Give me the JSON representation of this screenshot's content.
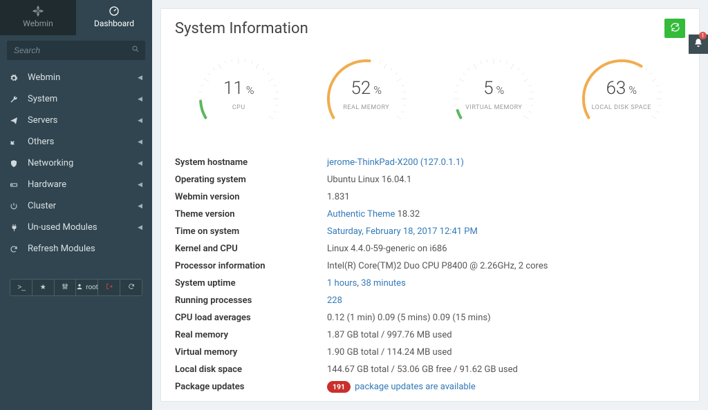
{
  "tabs": {
    "webmin": "Webmin",
    "dashboard": "Dashboard"
  },
  "search": {
    "placeholder": "Search"
  },
  "nav": {
    "items": [
      {
        "icon": "gear-icon",
        "label": "Webmin",
        "key": "webmin"
      },
      {
        "icon": "wrench-icon",
        "label": "System",
        "key": "system"
      },
      {
        "icon": "paperplane-icon",
        "label": "Servers",
        "key": "servers"
      },
      {
        "icon": "puzzle-icon",
        "label": "Others",
        "key": "others"
      },
      {
        "icon": "shield-icon",
        "label": "Networking",
        "key": "networking"
      },
      {
        "icon": "drive-icon",
        "label": "Hardware",
        "key": "hardware"
      },
      {
        "icon": "power-icon",
        "label": "Cluster",
        "key": "cluster"
      },
      {
        "icon": "plug-icon",
        "label": "Un-used Modules",
        "key": "unused"
      },
      {
        "icon": "refresh-icon",
        "label": "Refresh Modules",
        "key": "refresh",
        "no_chevron": true
      }
    ]
  },
  "bottombar": {
    "user_label": "root"
  },
  "notifications": {
    "count": "1"
  },
  "page": {
    "title": "System Information"
  },
  "gauges": [
    {
      "value": "11",
      "label": "CPU",
      "color": "#5cb85c"
    },
    {
      "value": "52",
      "label": "REAL MEMORY",
      "color": "#f0ad4e"
    },
    {
      "value": "5",
      "label": "VIRTUAL MEMORY",
      "color": "#5cb85c"
    },
    {
      "value": "63",
      "label": "LOCAL DISK SPACE",
      "color": "#f0ad4e"
    }
  ],
  "info": {
    "hostname_label": "System hostname",
    "hostname_value": "jerome-ThinkPad-X200 (127.0.1.1)",
    "os_label": "Operating system",
    "os_value": "Ubuntu Linux 16.04.1",
    "webmin_label": "Webmin version",
    "webmin_value": "1.831",
    "theme_label": "Theme version",
    "theme_link": "Authentic Theme",
    "theme_suffix": " 18.32",
    "time_label": "Time on system",
    "time_value": "Saturday, February 18, 2017 12:41 PM",
    "kernel_label": "Kernel and CPU",
    "kernel_value": "Linux 4.4.0-59-generic on i686",
    "proc_label": "Processor information",
    "proc_value": "Intel(R) Core(TM)2 Duo CPU P8400 @ 2.26GHz, 2 cores",
    "uptime_label": "System uptime",
    "uptime_hours": "1 hours",
    "uptime_sep": ", ",
    "uptime_minutes": "38 minutes",
    "procs_label": "Running processes",
    "procs_value": "228",
    "load_label": "CPU load averages",
    "load_value": "0.12 (1 min) 0.09 (5 mins) 0.09 (15 mins)",
    "realmem_label": "Real memory",
    "realmem_value": "1.87 GB total / 997.76 MB used",
    "virtmem_label": "Virtual memory",
    "virtmem_value": "1.90 GB total / 114.24 MB used",
    "disk_label": "Local disk space",
    "disk_value": "144.67 GB total / 53.06 GB free / 91.62 GB used",
    "packages_label": "Package updates",
    "packages_count": "191",
    "packages_text": "package updates are available"
  }
}
